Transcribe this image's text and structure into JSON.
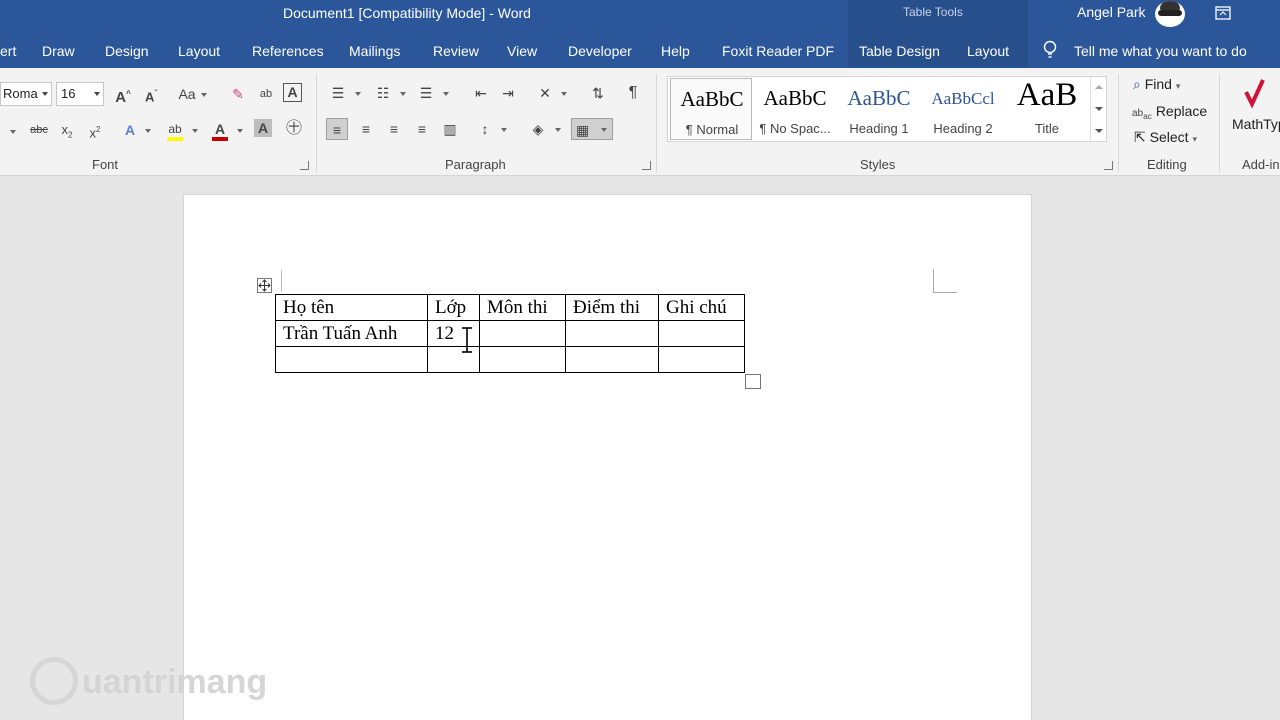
{
  "titlebar": {
    "document_title": "Document1 [Compatibility Mode]  -  Word",
    "contextual_label": "Table Tools",
    "user_name": "Angel Park"
  },
  "tabs": [
    "ert",
    "Draw",
    "Design",
    "Layout",
    "References",
    "Mailings",
    "Review",
    "View",
    "Developer",
    "Help",
    "Foxit Reader PDF",
    "Table Design",
    "Layout"
  ],
  "tell_me": "Tell me what you want to do",
  "ribbon": {
    "font": {
      "label": "Font",
      "font_name": "Roma",
      "font_size": "16",
      "case_label": "Aa"
    },
    "paragraph": {
      "label": "Paragraph"
    },
    "styles": {
      "label": "Styles",
      "items": [
        {
          "preview": "AaBbC",
          "name": "¶ Normal"
        },
        {
          "preview": "AaBbC",
          "name": "¶ No Spac..."
        },
        {
          "preview": "AaBbC",
          "name": "Heading 1"
        },
        {
          "preview": "AaBbCcl",
          "name": "Heading 2"
        },
        {
          "preview": "AaB",
          "name": "Title"
        }
      ]
    },
    "editing": {
      "label": "Editing",
      "find": "Find",
      "replace": "Replace",
      "select": "Select"
    },
    "addins": {
      "mathtype": "MathTyp",
      "label": "Add-in"
    }
  },
  "table": {
    "headers": [
      "Họ tên",
      "Lớp",
      "Môn thi",
      "Điểm thi",
      "Ghi chú"
    ],
    "rows": [
      [
        "Trần Tuấn Anh",
        "12",
        "",
        "",
        ""
      ],
      [
        "",
        "",
        "",
        "",
        ""
      ]
    ]
  },
  "watermark": "uantrimang",
  "colors": {
    "ribbon_blue": "#2b579a",
    "ribbon_gray": "#f3f3f3",
    "heading_blue": "#2f5496",
    "font_red": "#c00000",
    "highlight_yellow": "#ffff00"
  }
}
